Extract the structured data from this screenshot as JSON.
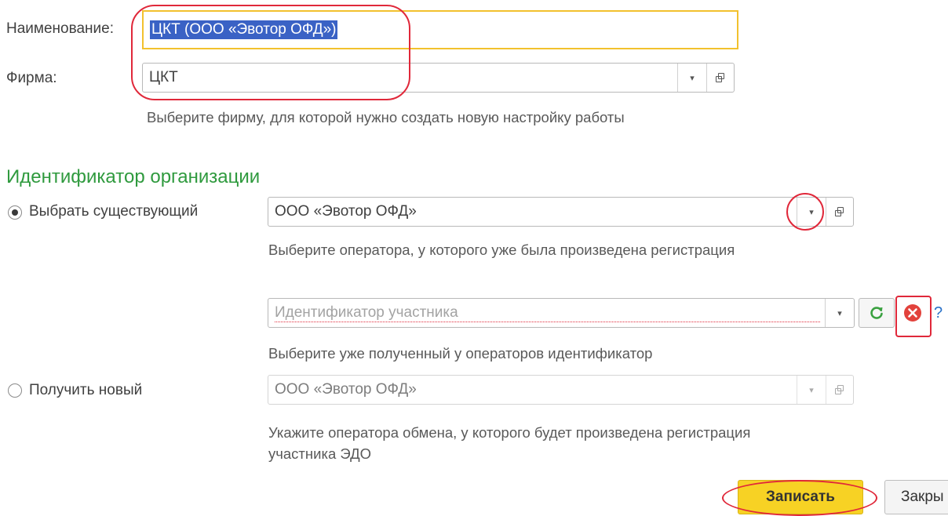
{
  "form": {
    "name_label": "Наименование:",
    "name_value": "ЦКТ (ООО «Эвотор ОФД»)",
    "firm_label": "Фирма:",
    "firm_value": "ЦКТ",
    "firm_hint": "Выберите фирму, для которой нужно создать новую настройку работы"
  },
  "org_section": {
    "title": "Идентификатор организации",
    "choose_existing_label": "Выбрать существующий",
    "choose_existing_selected": true,
    "existing_operator_value": "ООО «Эвотор ОФД»",
    "existing_operator_hint": "Выберите оператора, у которого уже была произведена регистрация",
    "participant_id_placeholder": "Идентификатор участника",
    "participant_id_hint": "Выберите уже полученный у операторов идентификатор",
    "help_mark": "?",
    "get_new_label": "Получить новый",
    "get_new_selected": false,
    "new_operator_value": "ООО «Эвотор ОФД»",
    "new_operator_hint": "Укажите оператора обмена, у которого будет произведена регистрация участника ЭДО"
  },
  "buttons": {
    "save_label": "Записать",
    "close_label": "Закры"
  },
  "icons": {
    "dropdown": "▾",
    "open": "open-in-window-icon",
    "refresh": "refresh-icon",
    "clear": "clear-icon"
  },
  "colors": {
    "section_title": "#2f9a3e",
    "highlight_border": "#f2c12e",
    "selection_bg": "#3a62c5",
    "save_button_bg": "#f7d224",
    "annotation_red": "#e0283a",
    "refresh_green": "#3aa140",
    "clear_red": "#e2423c",
    "help_blue": "#2a72c8"
  }
}
